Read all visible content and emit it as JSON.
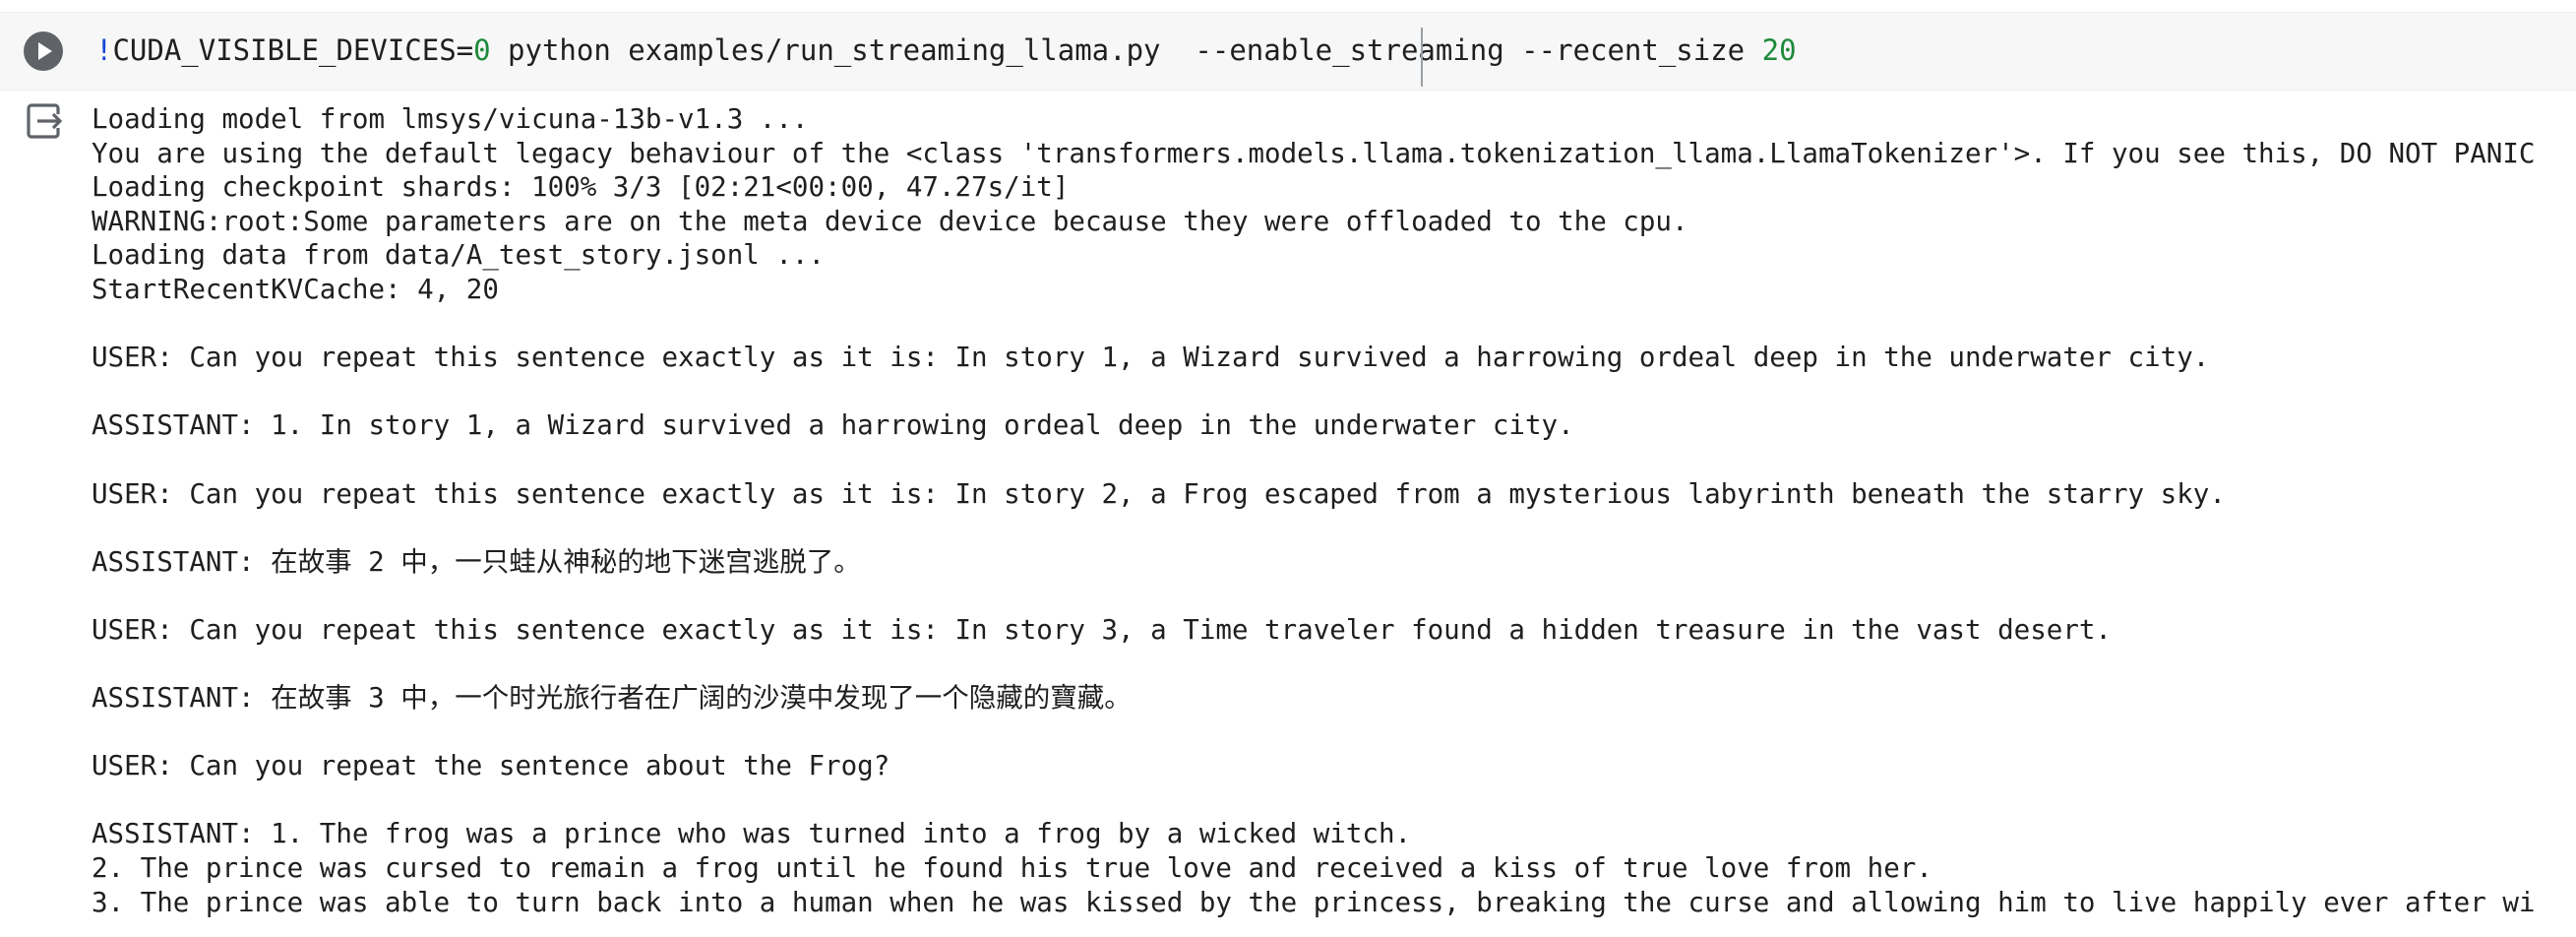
{
  "code_cell": {
    "run_button_icon": "play-icon",
    "code": {
      "bang": "!",
      "env_var": "CUDA_VISIBLE_DEVICES=",
      "device_id": "0",
      "command": " python examples/run_streaming_llama.py  --enable_streaming --recent_size ",
      "recent_size": "20"
    }
  },
  "output": {
    "icon": "output-redirect-icon",
    "lines": [
      "Loading model from lmsys/vicuna-13b-v1.3 ...",
      "You are using the default legacy behaviour of the <class 'transformers.models.llama.tokenization_llama.LlamaTokenizer'>. If you see this, DO NOT PANIC",
      "Loading checkpoint shards: 100% 3/3 [02:21<00:00, 47.27s/it]",
      "WARNING:root:Some parameters are on the meta device device because they were offloaded to the cpu.",
      "Loading data from data/A_test_story.jsonl ...",
      "StartRecentKVCache: 4, 20",
      "",
      "USER: Can you repeat this sentence exactly as it is: In story 1, a Wizard survived a harrowing ordeal deep in the underwater city.",
      "",
      "ASSISTANT: 1. In story 1, a Wizard survived a harrowing ordeal deep in the underwater city.",
      "",
      "USER: Can you repeat this sentence exactly as it is: In story 2, a Frog escaped from a mysterious labyrinth beneath the starry sky.",
      "",
      "ASSISTANT: 在故事 2 中，一只蛙从神秘的地下迷宫逃脱了。",
      "",
      "USER: Can you repeat this sentence exactly as it is: In story 3, a Time traveler found a hidden treasure in the vast desert.",
      "",
      "ASSISTANT: 在故事 3 中，一个时光旅行者在广阔的沙漠中发现了一个隐藏的寶藏。",
      "",
      "USER: Can you repeat the sentence about the Frog?",
      "",
      "ASSISTANT: 1. The frog was a prince who was turned into a frog by a wicked witch.",
      "2. The prince was cursed to remain a frog until he found his true love and received a kiss of true love from her.",
      "3. The prince was able to turn back into a human when he was kissed by the princess, breaking the curse and allowing him to live happily ever after wi"
    ]
  }
}
